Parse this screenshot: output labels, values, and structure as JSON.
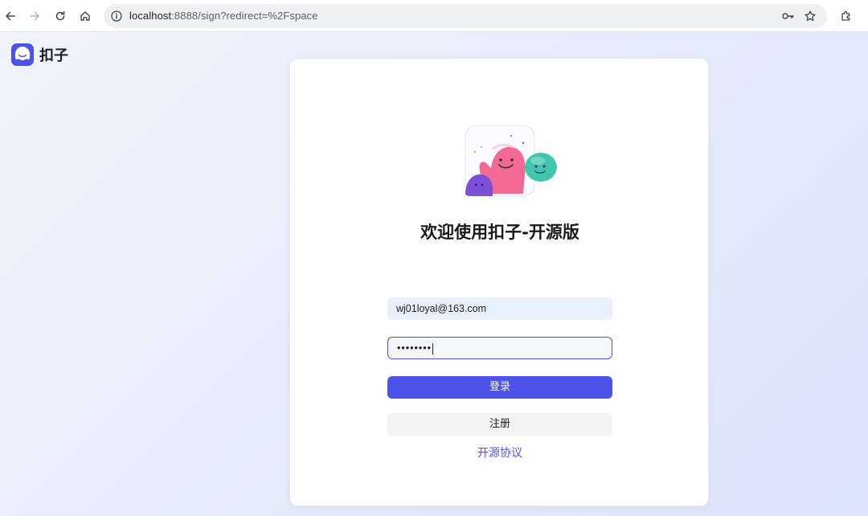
{
  "browser": {
    "url_host": "localhost",
    "url_rest": ":8888/sign?redirect=%2Fspace",
    "icons": {
      "back": "arrow-left-icon",
      "forward": "arrow-right-icon",
      "reload": "reload-icon",
      "home": "home-icon",
      "site_info": "info-icon",
      "password_manager": "key-icon",
      "bookmark": "star-icon",
      "extensions": "puzzle-icon"
    }
  },
  "brand": {
    "name": "扣子",
    "color": "#4d53e8"
  },
  "login": {
    "welcome_title": "欢迎使用扣子-开源版",
    "email_value": "wj01loyal@163.com",
    "password_value": "••••••••",
    "login_label": "登录",
    "register_label": "注册",
    "license_link": "开源协议",
    "accent_color": "#4d53e8"
  }
}
